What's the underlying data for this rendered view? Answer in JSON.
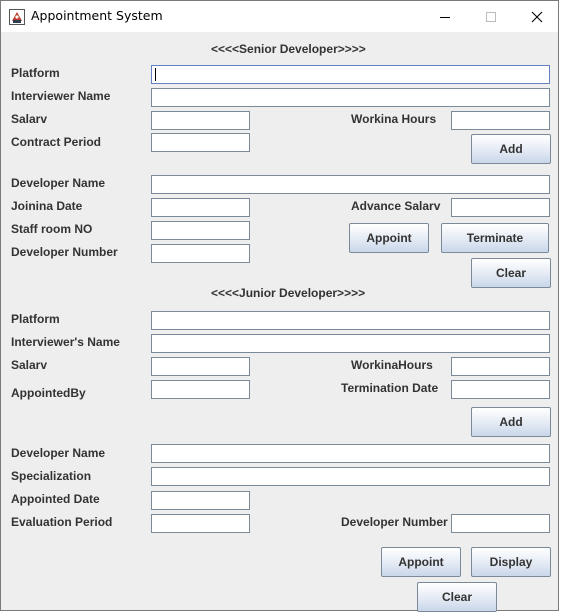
{
  "window": {
    "title": "Appointment System",
    "controls": [
      "minimize",
      "maximize",
      "close"
    ]
  },
  "senior": {
    "header": "<<<<Senior Developer>>>>",
    "platform_label": "Platform",
    "platform_value": "",
    "interviewer_name_label": "Interviewer Name",
    "interviewer_name_value": "",
    "salary_label": "Salarv",
    "salary_value": "",
    "working_hours_label": "Workina Hours",
    "working_hours_value": "",
    "contract_period_label": "Contract Period",
    "contract_period_value": "",
    "add_button": "Add",
    "developer_name_label": "Developer Name",
    "developer_name_value": "",
    "joining_date_label": "Joinina Date",
    "joining_date_value": "",
    "advance_salary_label": "Advance Salarv",
    "advance_salary_value": "",
    "staff_room_label": "Staff room NO",
    "staff_room_value": "",
    "developer_number_label": "Developer Number",
    "developer_number_value": "",
    "appoint_button": "Appoint",
    "terminate_button": "Terminate",
    "clear_button": "Clear"
  },
  "junior": {
    "header": "<<<<Junior Developer>>>>",
    "platform_label": "Platform",
    "platform_value": "",
    "interviewers_name_label": "Interviewer's Name",
    "interviewers_name_value": "",
    "salary_label": "Salarv",
    "salary_value": "",
    "working_hours_label": "WorkinaHours",
    "working_hours_value": "",
    "appointed_by_label": "AppointedBy",
    "appointed_by_value": "",
    "termination_date_label": "Termination Date",
    "termination_date_value": "",
    "add_button": "Add",
    "developer_name_label": "Developer Name",
    "developer_name_value": "",
    "specialization_label": "Specialization",
    "specialization_value": "",
    "appointed_date_label": "Appointed Date",
    "appointed_date_value": "",
    "evaluation_period_label": "Evaluation Period",
    "evaluation_period_value": "",
    "developer_number_label": "Developer Number",
    "developer_number_value": "",
    "appoint_button": "Appoint",
    "display_button": "Display",
    "clear_button": "Clear"
  }
}
